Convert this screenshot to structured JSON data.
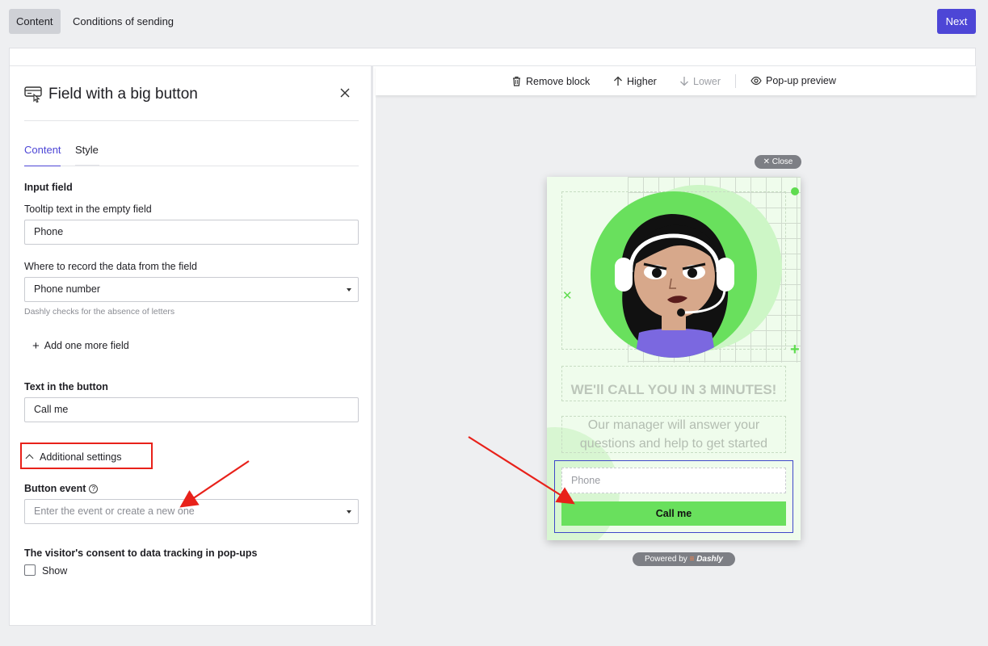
{
  "topbar": {
    "tabs": [
      {
        "label": "Content",
        "active": true
      },
      {
        "label": "Conditions of sending",
        "active": false
      }
    ],
    "next_label": "Next"
  },
  "panel": {
    "title": "Field with a big button",
    "subtabs": [
      {
        "label": "Content",
        "active": true
      },
      {
        "label": "Style",
        "active": false
      }
    ],
    "input_field_heading": "Input field",
    "tooltip_label": "Tooltip text in the empty field",
    "tooltip_value": "Phone",
    "record_label": "Where to record the data from the field",
    "record_value": "Phone number",
    "record_hint": "Dashly checks for the absence of letters",
    "add_field_label": "Add one more field",
    "button_text_heading": "Text in the button",
    "button_text_value": "Call me",
    "additional_settings_label": "Additional settings",
    "button_event_label": "Button event",
    "button_event_help": "?",
    "button_event_placeholder": "Enter the event or create a new one",
    "consent_heading": "The visitor's consent to data tracking in pop-ups",
    "consent_show_label": "Show",
    "consent_checked": false
  },
  "toolbar": {
    "remove_label": "Remove block",
    "higher_label": "Higher",
    "lower_label": "Lower",
    "preview_label": "Pop-up preview"
  },
  "popup": {
    "close_label": "Close",
    "title": "WE'll CALL YOU IN 3 MINUTES!",
    "text": "Our manager will answer your questions and help to get started",
    "input_placeholder": "Phone",
    "button_label": "Call me",
    "powered_prefix": "Powered by",
    "powered_brand": "Dashly"
  },
  "colors": {
    "accent": "#4d46d6",
    "popup_green": "#69e05d",
    "annotation_red": "#e8211a"
  }
}
